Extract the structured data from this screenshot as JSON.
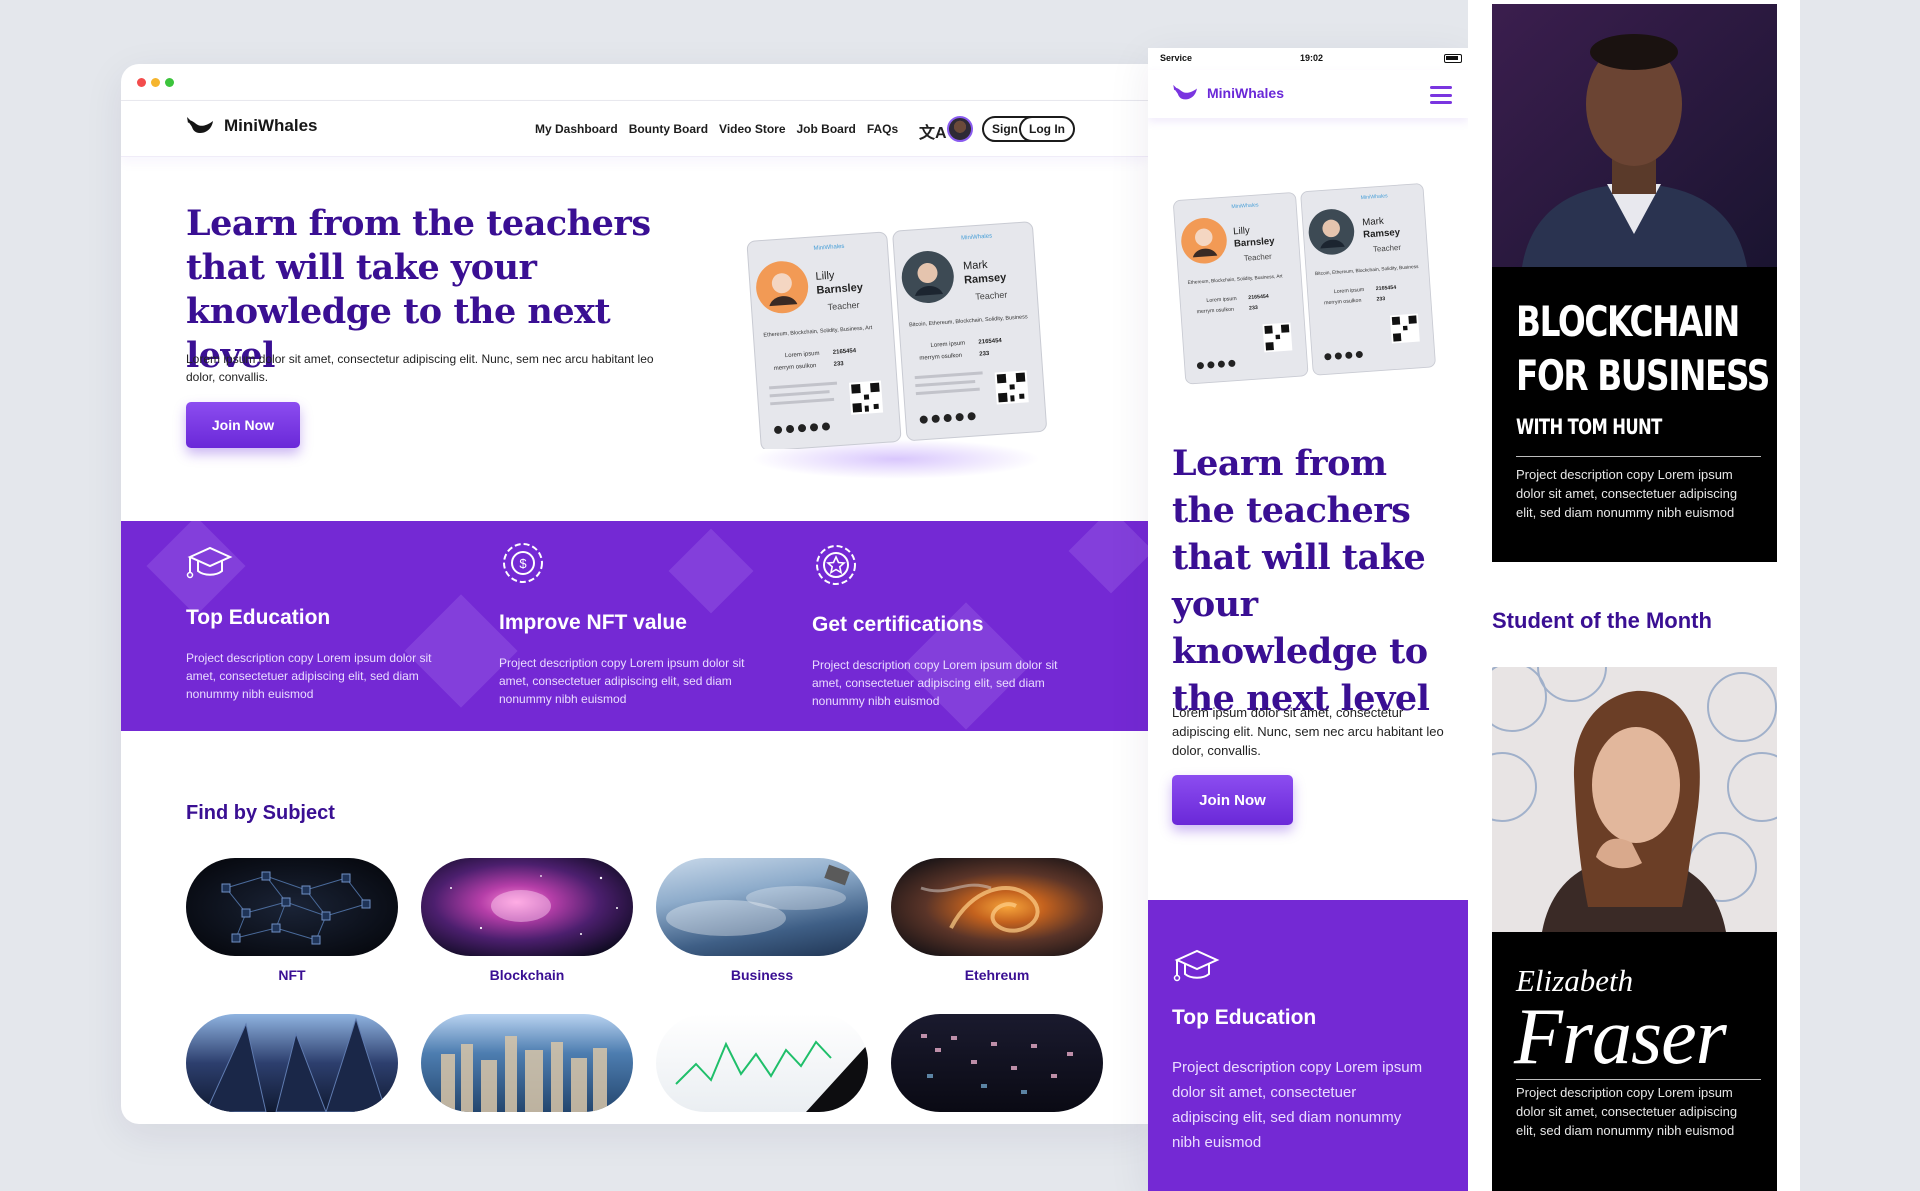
{
  "brand": {
    "name": "MiniWhales",
    "accent": "#7429d4",
    "heading": "#3a0f93"
  },
  "nav": {
    "links": [
      "My Dashboard",
      "Bounty Board",
      "Video Store",
      "Job Board",
      "FAQs"
    ],
    "translate_glyph": "文A",
    "signup": "Sign Up",
    "login": "Log In"
  },
  "hero": {
    "title": "Learn from the teachers that will take your knowledge to the next level",
    "subtitle": "Lorem ipsum dolor sit amet, consectetur adipiscing elit. Nunc, sem nec arcu habitant leo dolor, convallis.",
    "cta": "Join Now"
  },
  "id_cards": [
    {
      "brand": "MiniWhales",
      "first": "Lilly",
      "last": "Barnsley",
      "role": "Teacher",
      "skills": "Ethereum, Blockchain, Solidity, Business, Art",
      "field_label": "Lorem ipsum",
      "field_value": "2165454",
      "field2_label": "merrym osulkon",
      "field2_value": "233"
    },
    {
      "brand": "MiniWhales",
      "first": "Mark",
      "last": "Ramsey",
      "role": "Teacher",
      "skills": "Bitcoin, Ethereum, Blockchain, Solidity, Business",
      "field_label": "Lorem ipsum",
      "field_value": "2165454",
      "field2_label": "merrym osulkon",
      "field2_value": "233"
    }
  ],
  "features": [
    {
      "title": "Top Education",
      "desc": "Project description copy Lorem ipsum dolor sit amet, consectetuer adipiscing elit, sed diam nonummy nibh euismod",
      "icon": "graduation-cap-icon"
    },
    {
      "title": "Improve NFT value",
      "desc": "Project description copy Lorem ipsum dolor sit amet, consectetuer adipiscing elit, sed diam nonummy nibh euismod",
      "icon": "coin-badge-icon"
    },
    {
      "title": "Get certifications",
      "desc": "Project description copy Lorem ipsum dolor sit amet, consectetuer adipiscing elit, sed diam nonummy nibh euismod",
      "icon": "star-badge-icon"
    }
  ],
  "subjects": {
    "title": "Find by Subject",
    "items": [
      "NFT",
      "Blockchain",
      "Business",
      "Etehreum"
    ]
  },
  "mobile": {
    "carrier": "Service",
    "time": "19:02",
    "feature_title": "Top Education",
    "feature_desc": "Project description copy Lorem ipsum dolor sit amet, consectetuer adipiscing elit, sed diam nonummy nibh euismod"
  },
  "course": {
    "title_line1": "BLOCKCHAIN",
    "title_line2": "FOR BUSINESS",
    "subtitle": "WITH TOM HUNT",
    "desc": "Project description copy Lorem ipsum dolor sit amet, consectetuer adipiscing elit, sed diam nonummy nibh euismod"
  },
  "student": {
    "section_title": "Student of the Month",
    "first": "Elizabeth",
    "last": "Fraser",
    "desc": "Project description copy Lorem ipsum dolor sit amet, consectetuer adipiscing elit, sed diam nonummy nibh euismod"
  }
}
